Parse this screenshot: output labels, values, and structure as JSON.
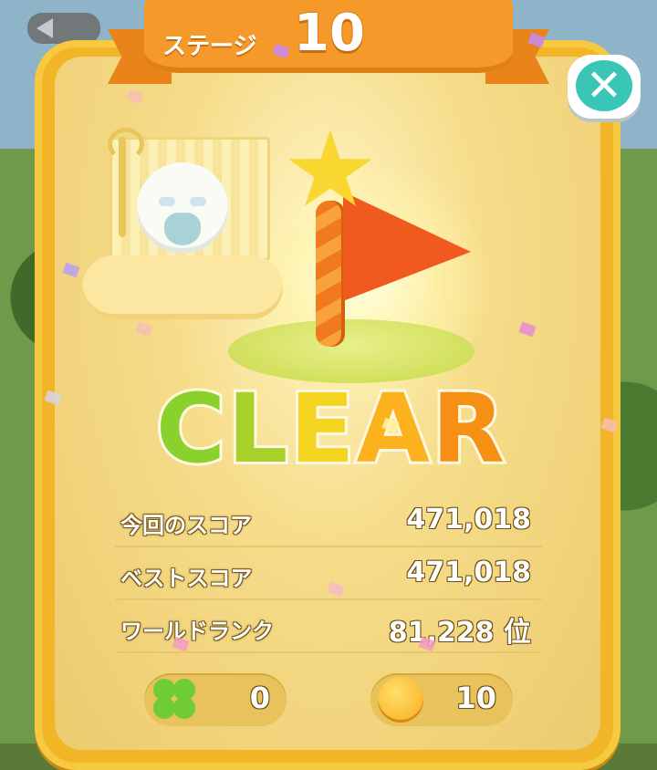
{
  "header": {
    "stage_label": "ステージ",
    "stage_number": "10",
    "close_icon": "close-icon"
  },
  "result": {
    "clear_text": [
      "C",
      "L",
      "E",
      "A",
      "R"
    ]
  },
  "stats": [
    {
      "label": "今回のスコア",
      "value": "471,018"
    },
    {
      "label": "ベストスコア",
      "value": "471,018"
    },
    {
      "label": "ワールドランク",
      "value": "81,228 位"
    }
  ],
  "rewards": {
    "clover": {
      "icon": "clover-icon",
      "value": "0"
    },
    "coin": {
      "icon": "coin-icon",
      "value": "10"
    }
  },
  "colors": {
    "panel": "#f3b528",
    "ribbon": "#f59a2a",
    "close_button": "#39c6b6"
  }
}
